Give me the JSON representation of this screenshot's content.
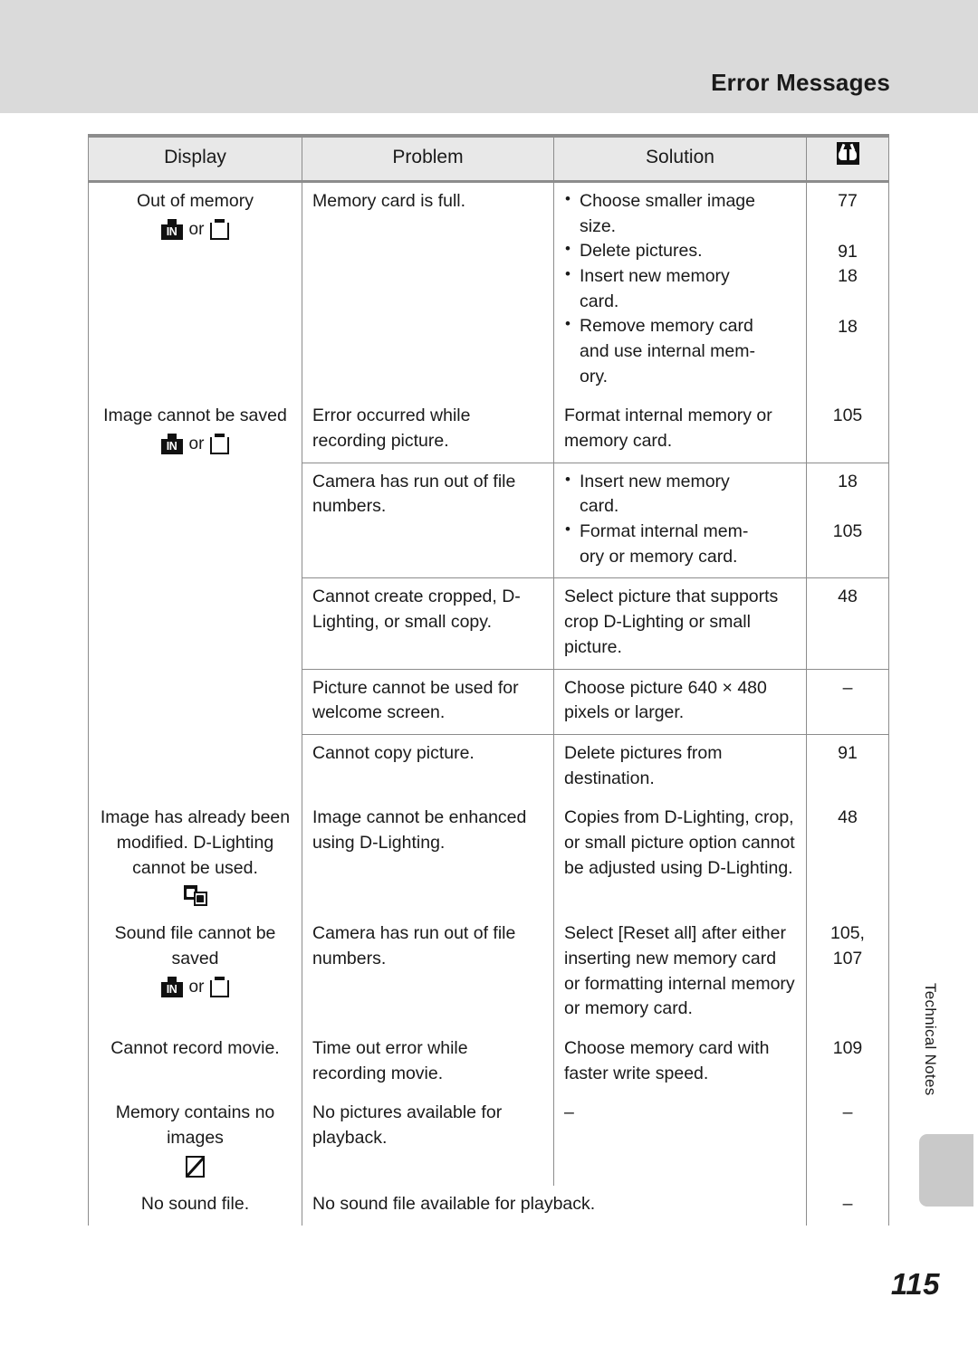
{
  "header": {
    "title": "Error Messages"
  },
  "side_tab": {
    "label": "Technical Notes"
  },
  "page_number": "115",
  "table": {
    "columns": {
      "display": "Display",
      "problem": "Problem",
      "solution": "Solution",
      "page_ref_icon": "open-book-icon"
    },
    "groups": [
      {
        "display": {
          "text": "Out of memory",
          "icons": [
            "internal-memory-icon",
            "memory-card-icon"
          ],
          "icon_separator": "or"
        },
        "rows": [
          {
            "problem": "Memory card is full.",
            "solution_bullets": [
              "Choose smaller image size.",
              "Delete pictures.",
              "Insert new memory card.",
              "Remove memory card and use internal mem-ory."
            ],
            "pages": [
              "77",
              "91",
              "18",
              "18"
            ]
          }
        ]
      },
      {
        "display": {
          "text": "Image cannot be saved",
          "icons": [
            "internal-memory-icon",
            "memory-card-icon"
          ],
          "icon_separator": "or"
        },
        "rows": [
          {
            "problem": "Error occurred while recording picture.",
            "solution": "Format internal memory or memory card.",
            "pages": [
              "105"
            ]
          },
          {
            "problem": "Camera has run out of file numbers.",
            "solution_bullets": [
              "Insert new memory card.",
              "Format internal mem-ory or memory card."
            ],
            "pages": [
              "18",
              "105"
            ]
          },
          {
            "problem": "Cannot create cropped, D-Lighting, or small copy.",
            "solution": "Select picture that supports crop D-Lighting or small picture.",
            "pages": [
              "48"
            ]
          },
          {
            "problem": "Picture cannot be used for welcome screen.",
            "solution": "Choose picture 640 × 480 pixels or larger.",
            "pages": [
              "–"
            ]
          },
          {
            "problem": "Cannot copy picture.",
            "solution": "Delete pictures from destination.",
            "pages": [
              "91"
            ]
          }
        ]
      },
      {
        "display": {
          "text": "Image has already been modified. D-Lighting cannot be used.",
          "icons": [
            "copy-images-icon"
          ],
          "icon_separator": ""
        },
        "rows": [
          {
            "problem": "Image cannot be enhanced using D-Lighting.",
            "solution": "Copies from D-Lighting, crop, or small picture option cannot be adjusted using D-Lighting.",
            "pages": [
              "48"
            ]
          }
        ]
      },
      {
        "display": {
          "text": "Sound file cannot be saved",
          "icons": [
            "internal-memory-icon",
            "memory-card-icon"
          ],
          "icon_separator": "or"
        },
        "rows": [
          {
            "problem": "Camera has run out of file numbers.",
            "solution": "Select [Reset all] after either inserting new memory card or formatting internal memory or memory card.",
            "pages": [
              "105,",
              "107"
            ]
          }
        ]
      },
      {
        "display": {
          "text": "Cannot record movie.",
          "icons": [],
          "icon_separator": ""
        },
        "rows": [
          {
            "problem": "Time out error while recording movie.",
            "solution": "Choose memory card with faster write speed.",
            "pages": [
              "109"
            ]
          }
        ]
      },
      {
        "display": {
          "text": "Memory contains no images",
          "icons": [
            "no-images-icon"
          ],
          "icon_separator": ""
        },
        "rows": [
          {
            "problem": "No pictures available for playback.",
            "solution": "–",
            "pages": [
              "–"
            ]
          }
        ]
      },
      {
        "display": {
          "text": "No sound file.",
          "icons": [],
          "icon_separator": ""
        },
        "rows": [
          {
            "problem_span": "No sound file available for playback.",
            "pages": [
              "–"
            ]
          }
        ]
      }
    ]
  },
  "text_fragments": {
    "g1_r1_s1a": "Choose smaller image",
    "g1_r1_s1b": "size.",
    "g1_r1_s2": "Delete pictures.",
    "g1_r1_s3a": "Insert new memory",
    "g1_r1_s3b": "card.",
    "g1_r1_s4a": "Remove memory card",
    "g1_r1_s4b": "and use internal mem-",
    "g1_r1_s4c": "ory.",
    "g2_r2_s1a": "Insert new memory",
    "g2_r2_s1b": "card.",
    "g2_r2_s2a": "Format internal mem-",
    "g2_r2_s2b": "ory or memory card."
  }
}
